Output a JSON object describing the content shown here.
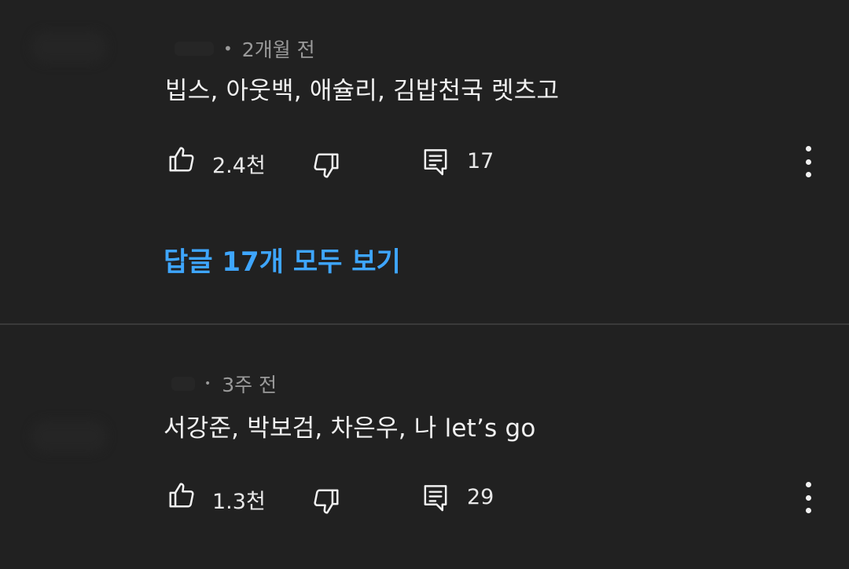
{
  "comments": [
    {
      "time": "2개월 전",
      "text": "빕스, 아웃백, 애슐리, 김밥천국 렛츠고",
      "likes": "2.4천",
      "reply_count": "17",
      "view_replies": "답글 17개 모두 보기"
    },
    {
      "time": "3주 전",
      "text": "서강준, 박보검, 차은우, 나 let’s go",
      "likes": "1.3천",
      "reply_count": "29"
    }
  ],
  "icons": {
    "like": "thumbs-up-icon",
    "dislike": "thumbs-down-icon",
    "reply": "comment-icon",
    "more": "more-vertical-icon"
  },
  "colors": {
    "background": "#212121",
    "text": "#f1f1f1",
    "meta": "#9a9a9a",
    "link": "#3ea6ff"
  }
}
